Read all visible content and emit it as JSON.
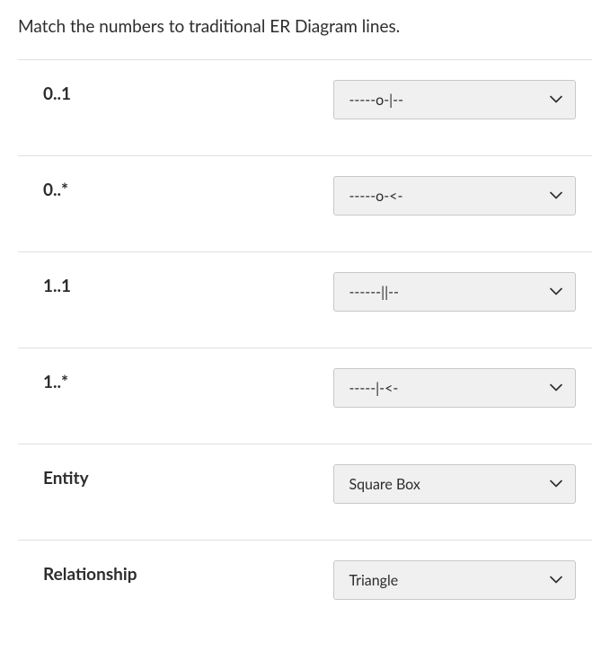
{
  "question": {
    "title": "Match the numbers to traditional ER Diagram lines."
  },
  "rows": [
    {
      "label": "0..1",
      "selected": "-----o-|--"
    },
    {
      "label": "0..*",
      "selected": "-----o-<-"
    },
    {
      "label": "1..1",
      "selected": "------||--"
    },
    {
      "label": "1..*",
      "selected": "-----|-<-"
    },
    {
      "label": "Entity",
      "selected": "Square Box"
    },
    {
      "label": "Relationship",
      "selected": "Triangle"
    }
  ]
}
